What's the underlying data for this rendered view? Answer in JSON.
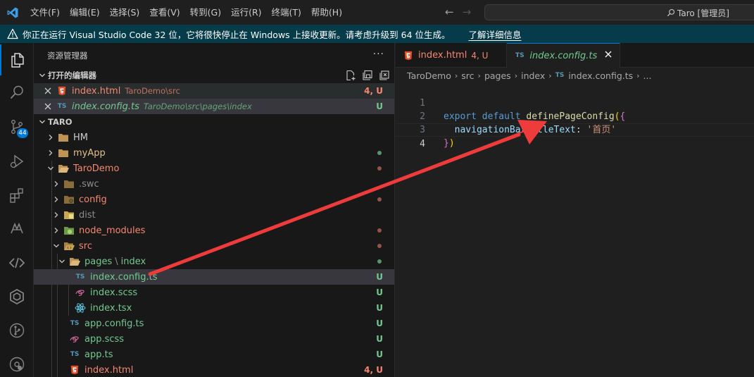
{
  "titlebar": {
    "menu": [
      "文件(F)",
      "编辑(E)",
      "选择(S)",
      "查看(V)",
      "转到(G)",
      "运行(R)",
      "终端(T)",
      "帮助(H)"
    ],
    "search_text": "Taro [管理员]"
  },
  "banner": {
    "message": "你正在运行 Visual Studio Code 32 位，它将很快停止在 Windows 上接收更新。请考虑升级到 64 位生成。",
    "link": "了解详细信息"
  },
  "activity": {
    "scm_badge": "44"
  },
  "sidebar": {
    "title": "资源管理器",
    "more": "···",
    "open_editors": {
      "title": "打开的编辑器",
      "items": [
        {
          "name": "index.html",
          "path": "TaroDemo\\src",
          "status": "4, U"
        },
        {
          "name": "index.config.ts",
          "path": "TaroDemo\\src\\pages\\index",
          "status": "U"
        }
      ]
    },
    "workspace": {
      "title": "TARO",
      "items": [
        {
          "name": "HM"
        },
        {
          "name": "myApp"
        },
        {
          "name": "TaroDemo"
        },
        {
          "name": ".swc"
        },
        {
          "name": "config"
        },
        {
          "name": "dist"
        },
        {
          "name": "node_modules"
        },
        {
          "name": "src"
        },
        {
          "name": "pages",
          "name2": "index",
          "sep": "\\"
        },
        {
          "name": "index.config.ts",
          "status": "U"
        },
        {
          "name": "index.scss",
          "status": "U"
        },
        {
          "name": "index.tsx",
          "status": "U"
        },
        {
          "name": "app.config.ts",
          "status": "U"
        },
        {
          "name": "app.scss",
          "status": "U"
        },
        {
          "name": "app.ts",
          "status": "U"
        },
        {
          "name": "index.html",
          "status": "4, U"
        }
      ]
    }
  },
  "editor": {
    "tabs": [
      {
        "name": "index.html",
        "status": "4, U",
        "active": false
      },
      {
        "name": "index.config.ts",
        "status": "",
        "active": true
      }
    ],
    "breadcrumb": [
      "TaroDemo",
      "src",
      "pages",
      "index",
      "index.config.ts",
      "..."
    ],
    "lines": [
      "1",
      "2",
      "3",
      "4"
    ],
    "code": {
      "l1_kw1": "export",
      "l1_kw2": "default",
      "l1_fn": "definePageConfig",
      "l1_paren": "(",
      "l1_brace": "{",
      "l2_prop": "navigationBarTitleText",
      "l2_colon": ":",
      "l2_str": "'首页'",
      "l3_brace": "}",
      "l3_paren": ")"
    }
  },
  "icon_names": {
    "ts": "TS"
  }
}
